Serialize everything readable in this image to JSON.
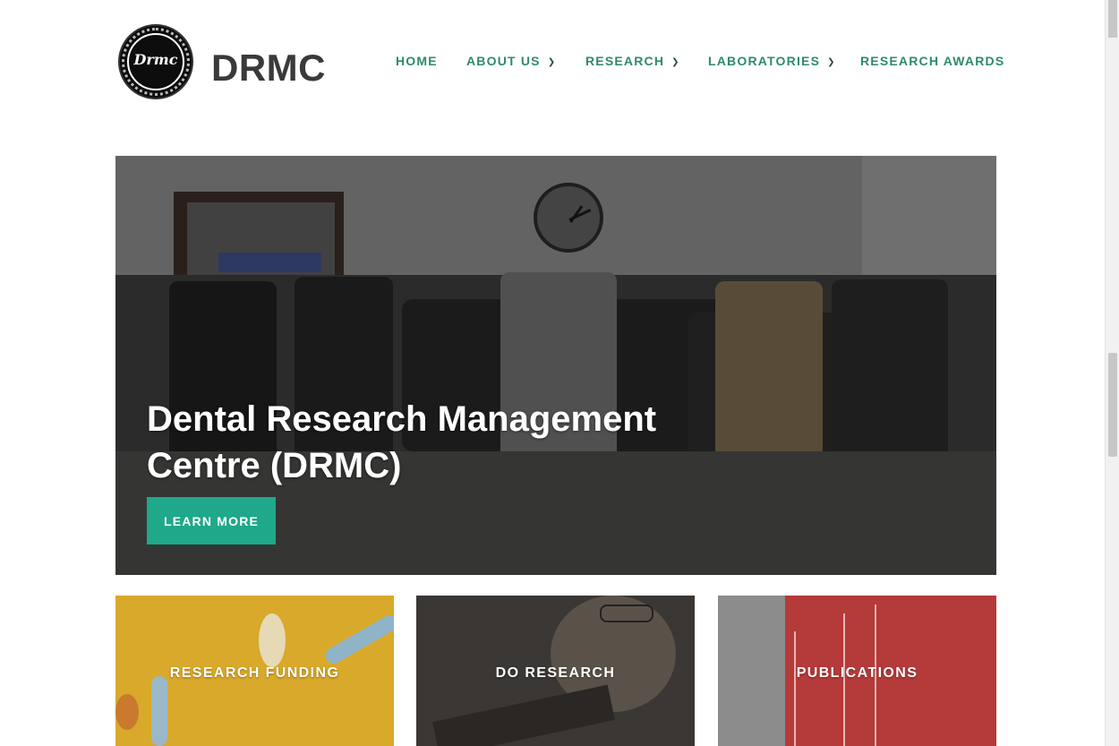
{
  "site": {
    "title": "DRMC",
    "logo_text": "Drmc"
  },
  "nav": {
    "items": [
      {
        "label": "HOME",
        "has_dropdown": false
      },
      {
        "label": "ABOUT US",
        "has_dropdown": true
      },
      {
        "label": "RESEARCH",
        "has_dropdown": true
      },
      {
        "label": "LABORATORIES",
        "has_dropdown": true
      },
      {
        "label": "RESEARCH AWARDS",
        "has_dropdown": false
      }
    ],
    "chevron_icon": "chevron-down-icon"
  },
  "hero": {
    "title": "Dental Research Management Centre (DRMC)",
    "button_label": "LEARN MORE"
  },
  "cards": [
    {
      "label": "RESEARCH FUNDING"
    },
    {
      "label": "DO RESEARCH"
    },
    {
      "label": "PUBLICATIONS"
    }
  ],
  "colors": {
    "accent": "#1fa88a",
    "nav_text": "#2e8a6b",
    "title_text": "#3a3a3a"
  }
}
